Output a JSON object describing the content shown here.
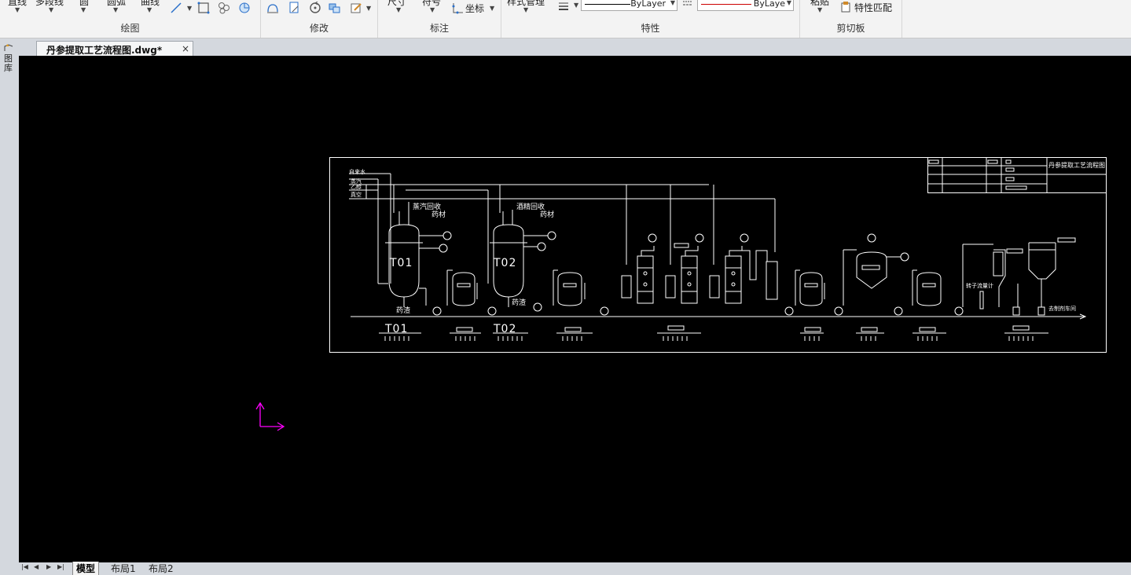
{
  "ribbon": {
    "draw": {
      "title": "绘图",
      "line": "直线",
      "polyline": "多段线",
      "circle": "圆",
      "arc": "圆弧",
      "curve": "曲线"
    },
    "modify": {
      "title": "修改"
    },
    "annotate": {
      "title": "标注",
      "dimension": "尺寸",
      "symbol": "符号",
      "coordinate": "坐标"
    },
    "properties": {
      "title": "特性",
      "style_manager": "样式管理",
      "linetype_value": "ByLayer",
      "color_value": "ByLaye",
      "line_color": "#000000",
      "color_line": "#cc0000"
    },
    "clipboard": {
      "title": "剪切板",
      "paste": "粘贴",
      "match_properties": "特性匹配"
    }
  },
  "side_panel": {
    "label": "图库"
  },
  "document": {
    "tab_title": "丹参提取工艺流程图.dwg*",
    "close_symbol": "×"
  },
  "drawing": {
    "title_block": "丹参提取工艺流程图",
    "utilities": [
      "自来水",
      "蒸汽",
      "乙醇",
      "真空"
    ],
    "tank1": "T01",
    "tank2": "T02",
    "steam_recovery": "蒸汽回收",
    "ethanol_recovery": "酒精回收",
    "herb1": "药材",
    "herb2": "药材",
    "residue1": "药渣",
    "residue2": "药渣",
    "flowmeter": "转子流量计",
    "to_next": "去制剂车间",
    "ucs_color": "#ff00ff"
  },
  "layouts": {
    "tabs": [
      "模型",
      "布局1",
      "布局2"
    ],
    "active": 0
  }
}
